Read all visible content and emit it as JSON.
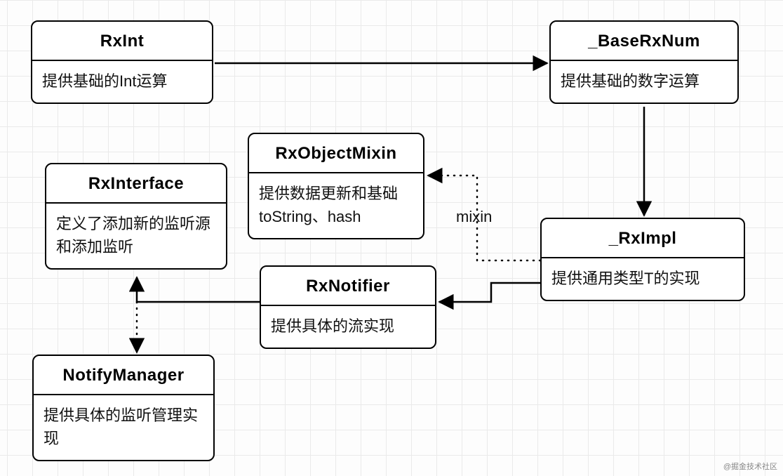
{
  "diagram": {
    "watermark": "@掘金技术社区",
    "nodes": {
      "rxint": {
        "title": "RxInt",
        "desc": "提供基础的Int运算"
      },
      "baserxnum": {
        "title": "_BaseRxNum",
        "desc": "提供基础的数字运算"
      },
      "rximpl": {
        "title": "_RxImpl",
        "desc": "提供通用类型T的实现"
      },
      "rxobjectmixin": {
        "title": "RxObjectMixin",
        "desc": "提供数据更新和基础toString、hash"
      },
      "rxnotifier": {
        "title": "RxNotifier",
        "desc": "提供具体的流实现"
      },
      "rxinterface": {
        "title": "RxInterface",
        "desc": "定义了添加新的监听源和添加监听"
      },
      "notifymanager": {
        "title": "NotifyManager",
        "desc": "提供具体的监听管理实现"
      }
    },
    "edges": {
      "mixin_label": "mixin"
    }
  }
}
